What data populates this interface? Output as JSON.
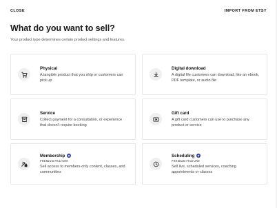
{
  "header": {
    "close_label": "CLOSE",
    "import_label": "IMPORT FROM ETSY"
  },
  "page": {
    "title": "What do you want to sell?",
    "subtitle": "Your product type determines certain product settings and features."
  },
  "product_types": [
    {
      "name": "Physical",
      "icon": "shopping-cart-icon",
      "description": "A tangible product that you ship or customers can pick up",
      "premium": false
    },
    {
      "name": "Digital download",
      "icon": "download-icon",
      "description": "A digital file customers can download, like an ebook, PDF template, or audio file",
      "premium": false
    },
    {
      "name": "Service",
      "icon": "service-icon",
      "description": "Collect payment for a consultation, or experience that doesn't require booking",
      "premium": false
    },
    {
      "name": "Gift card",
      "icon": "gift-card-icon",
      "description": "A gift card customers can use to purchase any product or service",
      "premium": false
    },
    {
      "name": "Membership",
      "icon": "membership-icon",
      "description": "Sell access to members-only content, classes, and communities",
      "premium": true,
      "premium_label": "PREMIUM FEATURE"
    },
    {
      "name": "Scheduling",
      "icon": "clock-icon",
      "description": "Sell live, scheduled services, coaching appointments or classes",
      "premium": true,
      "premium_label": "PREMIUM FEATURE"
    }
  ],
  "colors": {
    "badge": "#2f3f9e",
    "icon_bg": "#efefef",
    "border": "#e7e7e7"
  }
}
